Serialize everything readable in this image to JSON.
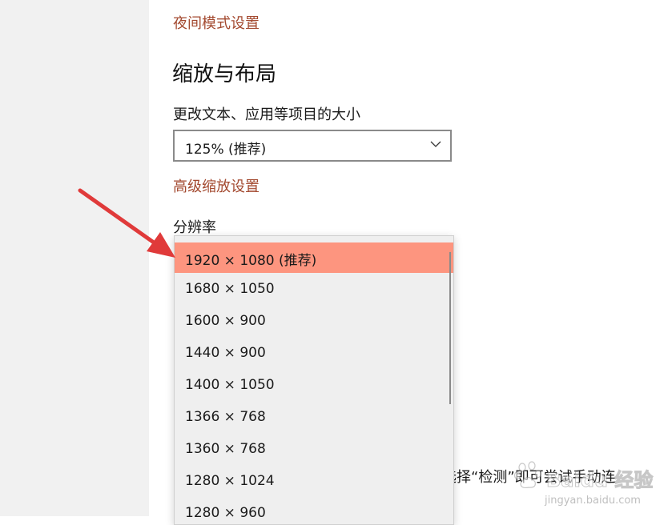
{
  "links": {
    "night_mode": "夜间模式设置",
    "advanced_scaling": "高级缩放设置"
  },
  "section": {
    "title": "缩放与布局"
  },
  "scale": {
    "label": "更改文本、应用等项目的大小",
    "value": "125% (推荐)"
  },
  "resolution": {
    "label": "分辨率",
    "options": [
      "1920 × 1080 (推荐)",
      "1680 × 1050",
      "1600 × 900",
      "1440 × 900",
      "1400 × 1050",
      "1366 × 768",
      "1360 × 768",
      "1280 × 1024",
      "1280 × 960"
    ],
    "selected_index": 0
  },
  "background_text": "选择“检测”即可尝试手动连",
  "watermark": {
    "text": "Baidu 经验",
    "sub": "jingyan.baidu.com"
  },
  "colors": {
    "link": "#a3492f",
    "selected_option": "#fd957f",
    "arrow": "#e03a3a"
  },
  "icons": {
    "dropdown_chevron": "chevron-down-icon",
    "annotation": "red-arrow-icon"
  }
}
